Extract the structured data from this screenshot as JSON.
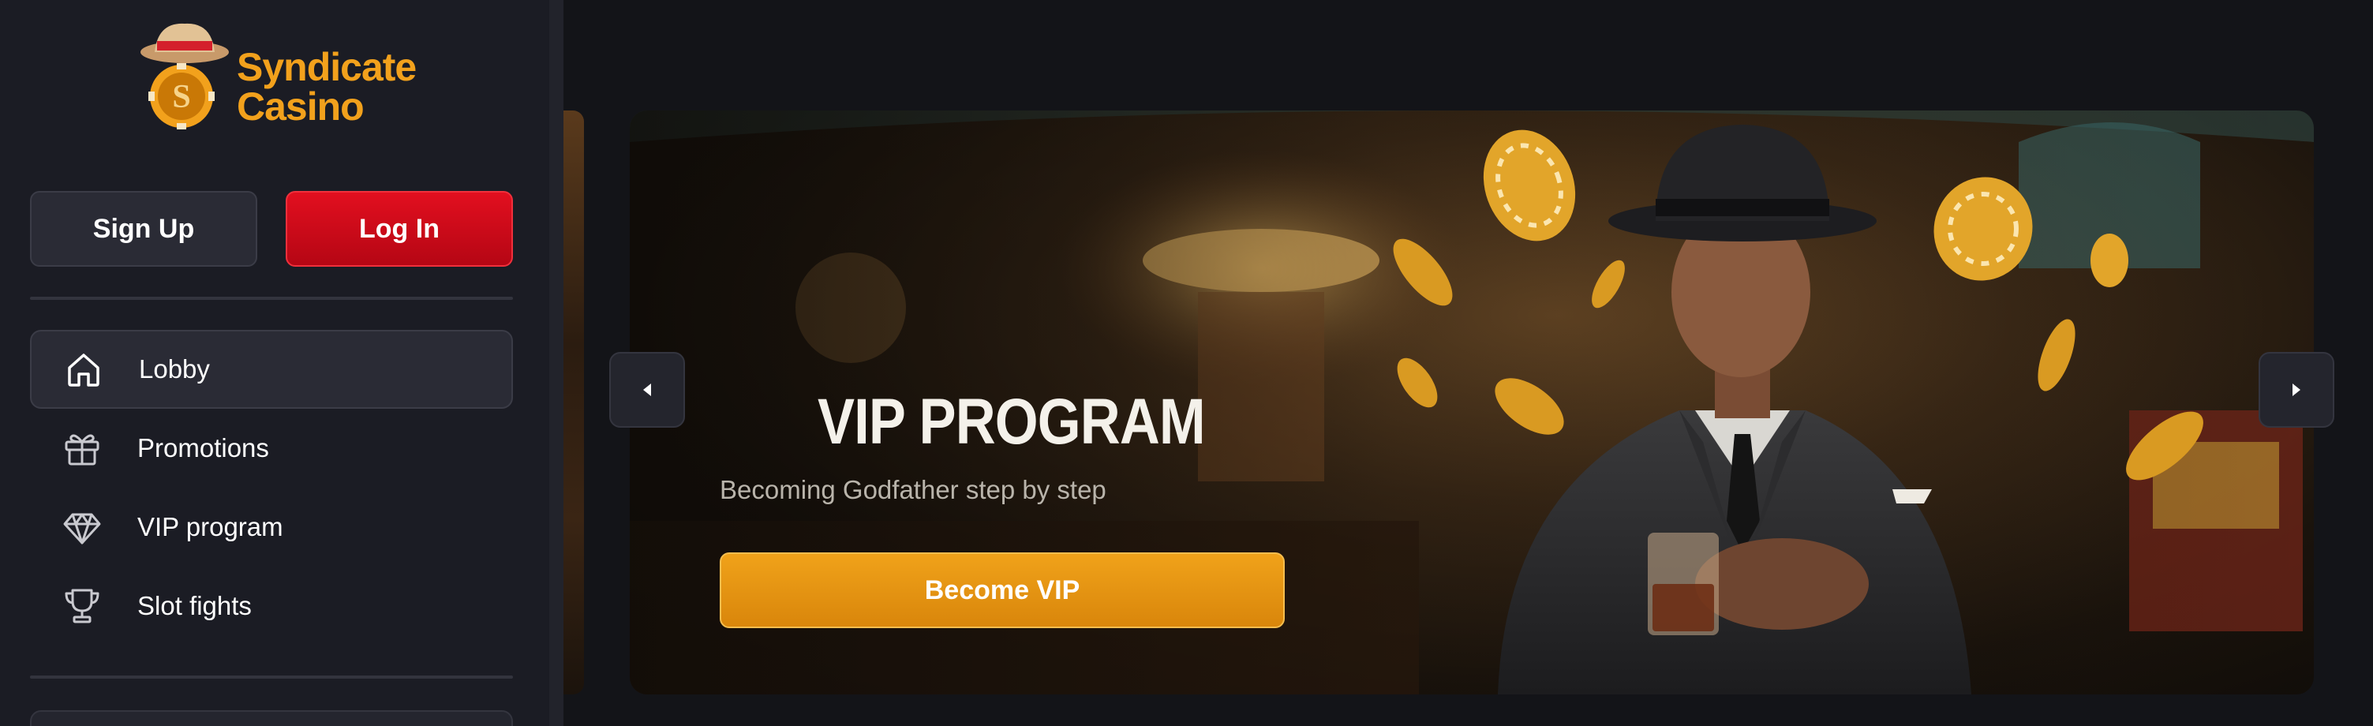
{
  "brand": {
    "name_line1": "Syndicate",
    "name_line2": "Casino",
    "logo_letter": "S",
    "accent_color": "#f2a11c"
  },
  "auth": {
    "signup_label": "Sign Up",
    "login_label": "Log In"
  },
  "sidebar": {
    "items": [
      {
        "label": "Lobby",
        "icon": "home-icon",
        "active": true
      },
      {
        "label": "Promotions",
        "icon": "gift-icon",
        "active": false
      },
      {
        "label": "VIP program",
        "icon": "diamond-icon",
        "active": false
      },
      {
        "label": "Slot fights",
        "icon": "trophy-icon",
        "active": false
      }
    ]
  },
  "banner": {
    "title": "VIP PROGRAM",
    "subtitle": "Becoming Godfather step by step",
    "cta_label": "Become VIP",
    "prev_icon": "caret-left-icon",
    "next_icon": "caret-right-icon"
  },
  "colors": {
    "login_red": "#e20f1f",
    "cta_orange": "#f0a21a",
    "sidebar_bg": "#1b1c24"
  }
}
